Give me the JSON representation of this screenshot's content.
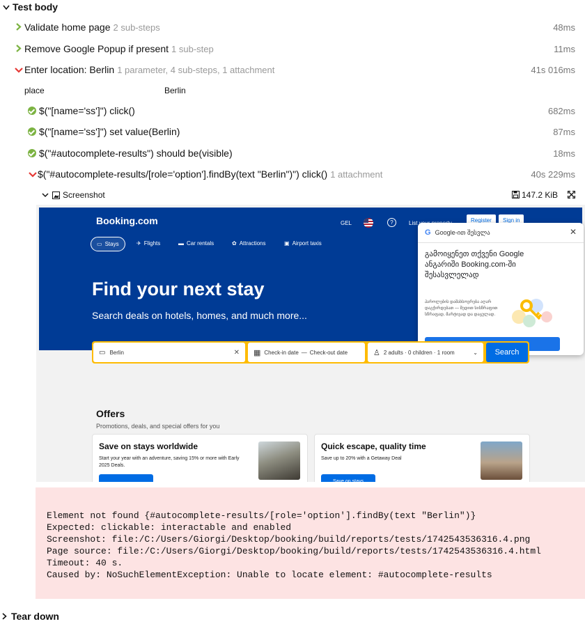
{
  "section_body": {
    "title": "Test body"
  },
  "steps": [
    {
      "name": "Validate home page",
      "meta": "2 sub-steps",
      "duration": "48ms"
    },
    {
      "name": "Remove Google Popup if present",
      "meta": "1 sub-step",
      "duration": "11ms"
    },
    {
      "name": "Enter location: Berlin",
      "meta": "1 parameter, 4 sub-steps, 1 attachment",
      "duration": "41s 016ms"
    }
  ],
  "parameter": {
    "name": "place",
    "value": "Berlin"
  },
  "substeps": [
    {
      "name": "$(\"[name='ss']\") click()",
      "meta": "",
      "duration": "682ms"
    },
    {
      "name": "$(\"[name='ss']\") set value(Berlin)",
      "meta": "",
      "duration": "87ms"
    },
    {
      "name": "$(\"#autocomplete-results\") should be(visible)",
      "meta": "",
      "duration": "18ms"
    },
    {
      "name": "$(\"#autocomplete-results/[role='option'].findBy(text \"Berlin\")\") click()",
      "meta": "1 attachment",
      "duration": "40s 229ms"
    }
  ],
  "attachment": {
    "title": "Screenshot",
    "size": "147.2 KiB"
  },
  "screenshot": {
    "logo": "Booking.com",
    "currency": "GEL",
    "list_property": "List your property",
    "register": "Register",
    "signin": "Sign in",
    "nav": [
      "Stays",
      "Flights",
      "Car rentals",
      "Attractions",
      "Airport taxis"
    ],
    "headline": "Find your next stay",
    "subline": "Search deals on hotels, homes, and much more...",
    "destination": "Berlin",
    "checkin": "Check-in date",
    "dash": "—",
    "checkout": "Check-out date",
    "guests": "2 adults · 0 children · 1 room",
    "search_button": "Search",
    "google_popup": {
      "header": "Google-ით შესვლა",
      "title": "გამოიყენეთ თქვენი Google ანგარიში Booking.com-ში შესასვლელად",
      "text": "პაროლების დამახსოვრება აღარ დაგჭირდებათ — შედით სისწრაფით სწრაფად, მარტივად და დაცულად."
    },
    "offers_title": "Offers",
    "offers_sub": "Promotions, deals, and special offers for you",
    "card1": {
      "title": "Save on stays worldwide",
      "desc": "Start your year with an adventure, saving 15% or more with Early 2025 Deals.",
      "button": ""
    },
    "card2": {
      "title": "Quick escape, quality time",
      "desc": "Save up to 20% with a Getaway Deal",
      "button": "Save on stays"
    }
  },
  "error": {
    "lines": "Element not found {#autocomplete-results/[role='option'].findBy(text \"Berlin\")}\nExpected: clickable: interactable and enabled\nScreenshot: file:/C:/Users/Giorgi/Desktop/booking/build/reports/tests/1742543536316.4.png\nPage source: file:/C:/Users/Giorgi/Desktop/booking/build/reports/tests/1742543536316.4.html\nTimeout: 40 s.\nCaused by: NoSuchElementException: Unable to locate element: #autocomplete-results"
  },
  "section_teardown": {
    "title": "Tear down"
  },
  "colors": {
    "pass": "#7cb342",
    "fail": "#e53935",
    "booking_blue": "#003b95",
    "search_yellow": "#febb02",
    "error_bg": "#fde3e3"
  }
}
